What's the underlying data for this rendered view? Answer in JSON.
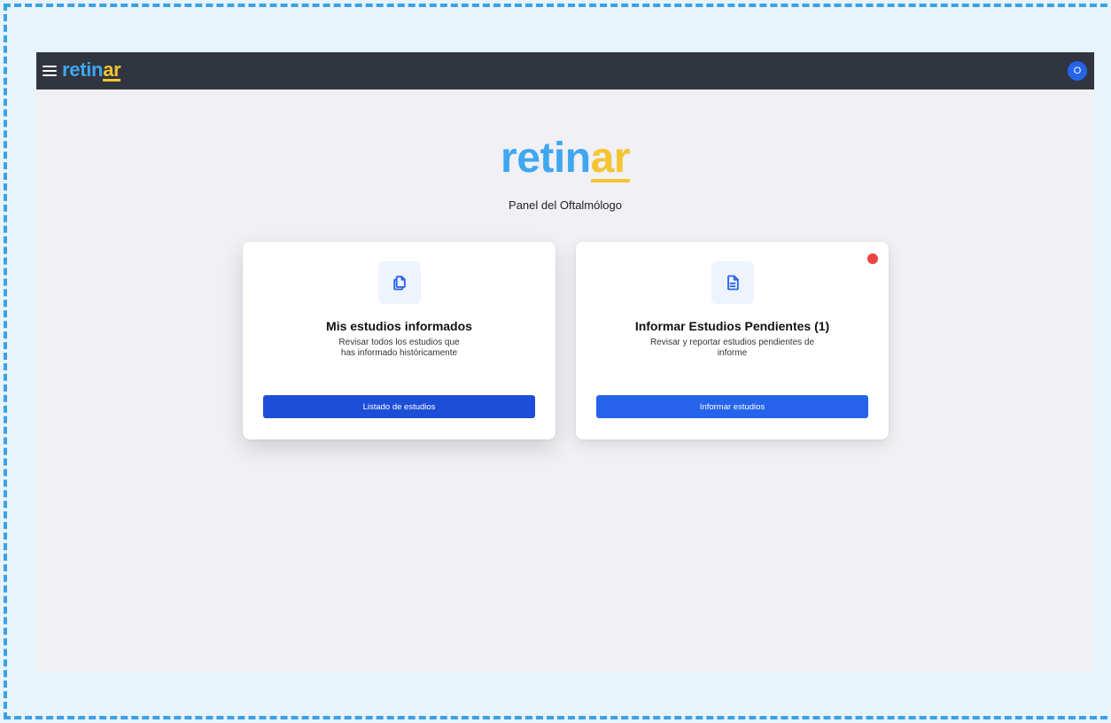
{
  "header": {
    "brand_part1": "retin",
    "brand_part2": "ar",
    "avatar_initial": "O"
  },
  "hero": {
    "brand_part1": "retin",
    "brand_part2": "ar",
    "subtitle": "Panel del Oftalmólogo"
  },
  "cards": [
    {
      "icon": "copy-documents-icon",
      "title": "Mis estudios informados",
      "description": "Revisar todos los estudios que has informado históricamente",
      "button_label": "Listado de estudios"
    },
    {
      "icon": "document-text-icon",
      "title": "Informar Estudios Pendientes (1)",
      "description": "Revisar y reportar estudios pendientes de informe",
      "button_label": "Informar estudios",
      "notification": true
    }
  ],
  "colors": {
    "brand_blue": "#3ea7f0",
    "brand_yellow": "#f5c431",
    "topbar": "#30353f",
    "primary_button": "#1d4ed8",
    "secondary_button": "#2563eb",
    "notification": "#ef4444"
  }
}
